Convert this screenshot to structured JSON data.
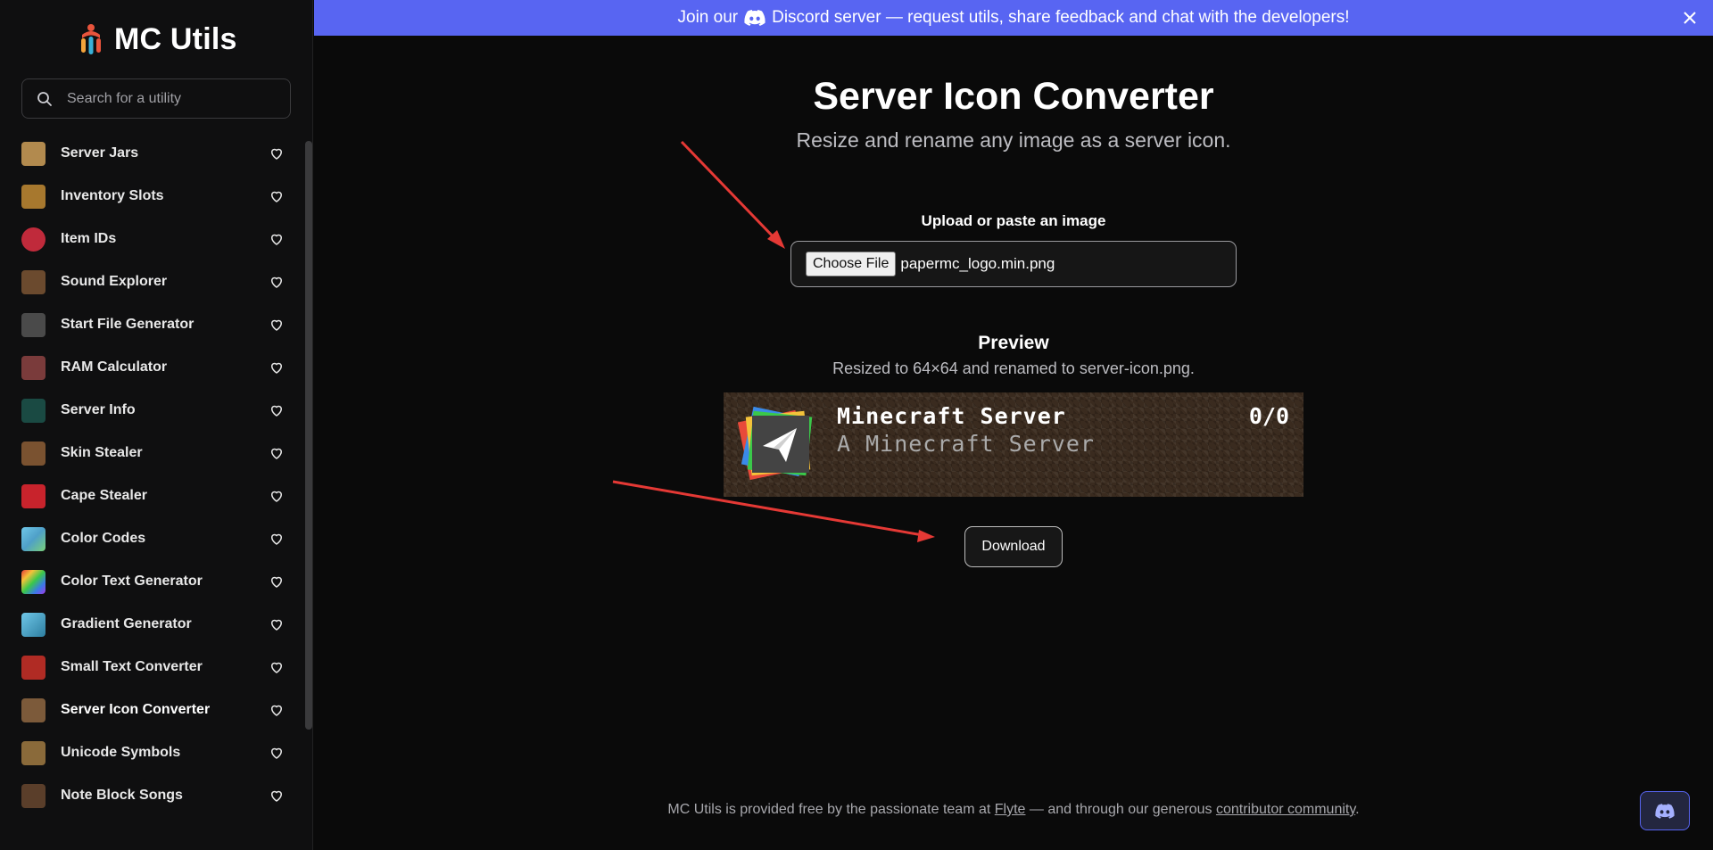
{
  "app": {
    "name": "MC Utils"
  },
  "search": {
    "placeholder": "Search for a utility"
  },
  "sidebar": {
    "items": [
      {
        "label": "Server Jars",
        "icon": "server-jars-icon",
        "color": "#b28a4e",
        "active": false
      },
      {
        "label": "Inventory Slots",
        "icon": "chest-icon",
        "color": "#a7782e",
        "active": false
      },
      {
        "label": "Item IDs",
        "icon": "apple-icon",
        "color": "#c02a3b",
        "active": false
      },
      {
        "label": "Sound Explorer",
        "icon": "note-block-icon",
        "color": "#6b4a2e",
        "active": false
      },
      {
        "label": "Start File Generator",
        "icon": "command-block-icon",
        "color": "#4a4a4a",
        "active": false
      },
      {
        "label": "RAM Calculator",
        "icon": "ram-block-icon",
        "color": "#7a3b3b",
        "active": false
      },
      {
        "label": "Server Info",
        "icon": "sculk-sensor-icon",
        "color": "#1a4a43",
        "active": false
      },
      {
        "label": "Skin Stealer",
        "icon": "steve-head-icon",
        "color": "#7a5230",
        "active": false
      },
      {
        "label": "Cape Stealer",
        "icon": "cape-icon",
        "color": "#c8232c",
        "active": false
      },
      {
        "label": "Color Codes",
        "icon": "color-block-icon",
        "color": "#4fa0c8",
        "active": false
      },
      {
        "label": "Color Text Generator",
        "icon": "rainbow-block-icon",
        "color": "#d4a12a",
        "active": false
      },
      {
        "label": "Gradient Generator",
        "icon": "gradient-block-icon",
        "color": "#2d7ea0",
        "active": false
      },
      {
        "label": "Small Text Converter",
        "icon": "small-text-block-icon",
        "color": "#b02b24",
        "active": false
      },
      {
        "label": "Server Icon Converter",
        "icon": "dirt-block-icon",
        "color": "#7c5a3a",
        "active": true
      },
      {
        "label": "Unicode Symbols",
        "icon": "unicode-block-icon",
        "color": "#8a6a3a",
        "active": false
      },
      {
        "label": "Note Block Songs",
        "icon": "jukebox-icon",
        "color": "#5a3e2a",
        "active": false
      }
    ]
  },
  "banner": {
    "text_before": "Join our",
    "text_after": "Discord server — request utils, share feedback and chat with the developers!",
    "color": "#5865f2"
  },
  "page": {
    "title": "Server Icon Converter",
    "subtitle": "Resize and rename any image as a server icon."
  },
  "upload": {
    "label": "Upload or paste an image",
    "button_label": "Choose File",
    "file_name": "papermc_logo.min.png"
  },
  "preview": {
    "title": "Preview",
    "subtitle": "Resized to 64×64 and renamed to server-icon.png.",
    "server_name": "Minecraft Server",
    "motd": "A Minecraft Server",
    "players": "0/0"
  },
  "download": {
    "label": "Download"
  },
  "footer": {
    "text1": "MC Utils is provided free by the passionate team at",
    "link1": "Flyte",
    "text2": "— and through our generous",
    "link2": "contributor community",
    "text3": "."
  }
}
